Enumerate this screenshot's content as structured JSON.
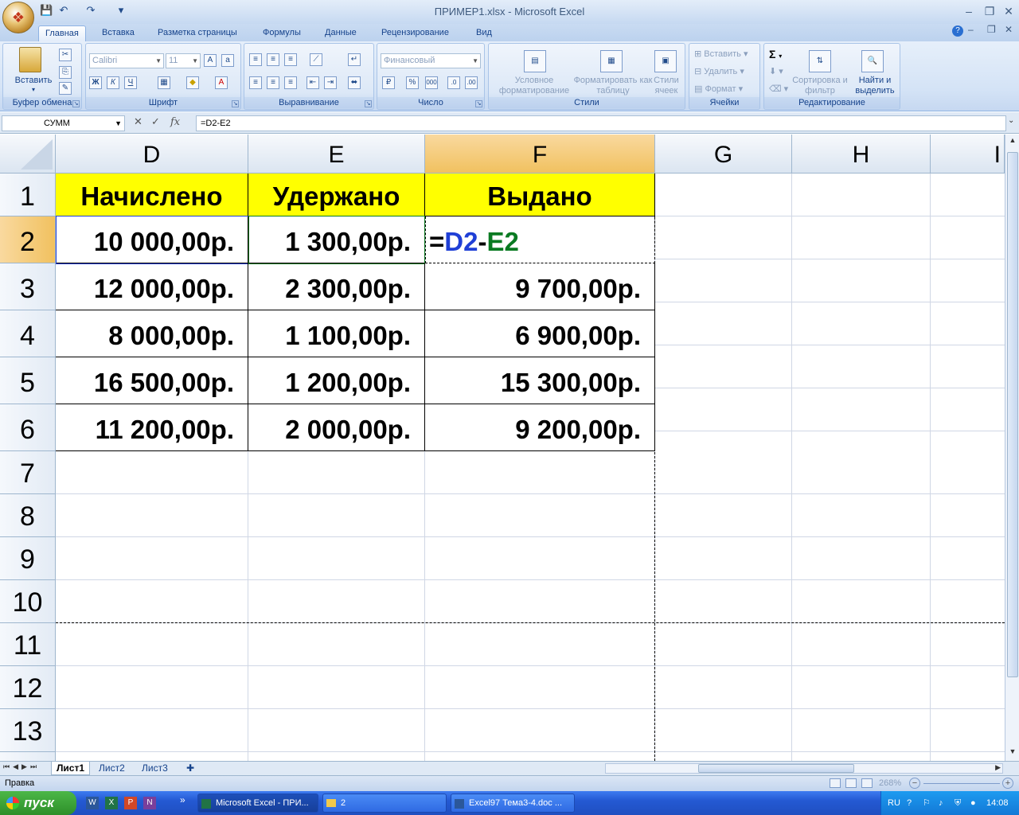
{
  "window": {
    "title": "ПРИМЕР1.xlsx - Microsoft Excel"
  },
  "qat": {
    "save": "💾",
    "undo": "↶",
    "redo": "↷",
    "more": "▾"
  },
  "tabs": [
    "Главная",
    "Вставка",
    "Разметка страницы",
    "Формулы",
    "Данные",
    "Рецензирование",
    "Вид"
  ],
  "ribbon": {
    "clipboard": {
      "label": "Буфер обмена",
      "paste": "Вставить"
    },
    "font": {
      "label": "Шрифт",
      "family": "Calibri",
      "size": "11",
      "bold": "Ж",
      "italic": "К",
      "underline": "Ч"
    },
    "alignment": {
      "label": "Выравнивание"
    },
    "number": {
      "label": "Число",
      "format": "Финансовый"
    },
    "styles": {
      "label": "Стили",
      "cond_fmt": "Условное форматирование",
      "fmt_table": "Форматировать как таблицу",
      "cell_styles": "Стили ячеек"
    },
    "cells": {
      "label": "Ячейки",
      "insert": "Вставить",
      "delete": "Удалить",
      "format": "Формат"
    },
    "editing": {
      "label": "Редактирование",
      "sort": "Сортировка и фильтр",
      "find": "Найти и выделить"
    }
  },
  "formula_bar": {
    "name_box": "СУММ",
    "fx": "fx",
    "formula": "=D2-E2"
  },
  "columns": [
    "D",
    "E",
    "F",
    "G",
    "H",
    "I"
  ],
  "rows": [
    "1",
    "2",
    "3",
    "4",
    "5",
    "6",
    "7",
    "8",
    "9",
    "10",
    "11",
    "12",
    "13"
  ],
  "table": {
    "headers": [
      "Начислено",
      "Удержано",
      "Выдано"
    ],
    "data": [
      [
        "10 000,00р.",
        "1 300,00р.",
        ""
      ],
      [
        "12 000,00р.",
        "2 300,00р.",
        "9 700,00р."
      ],
      [
        "8 000,00р.",
        "1 100,00р.",
        "6 900,00р."
      ],
      [
        "16 500,00р.",
        "1 200,00р.",
        "15 300,00р."
      ],
      [
        "11 200,00р.",
        "2 000,00р.",
        "9 200,00р."
      ]
    ],
    "edit_formula": {
      "eq": "=",
      "ref1": "D2",
      "minus": "-",
      "ref2": "E2"
    }
  },
  "sheets": [
    "Лист1",
    "Лист2",
    "Лист3"
  ],
  "status": {
    "mode": "Правка",
    "zoom": "268%"
  },
  "taskbar": {
    "start": "пуск",
    "tasks": [
      "Microsoft Excel - ПРИ...",
      "2",
      "Excel97 Тема3-4.doc ..."
    ],
    "lang": "RU",
    "clock": "14:08"
  },
  "colors": {
    "ref1": "#1f3fd6",
    "ref2": "#0a7a22",
    "header_fill": "#ffff00"
  }
}
